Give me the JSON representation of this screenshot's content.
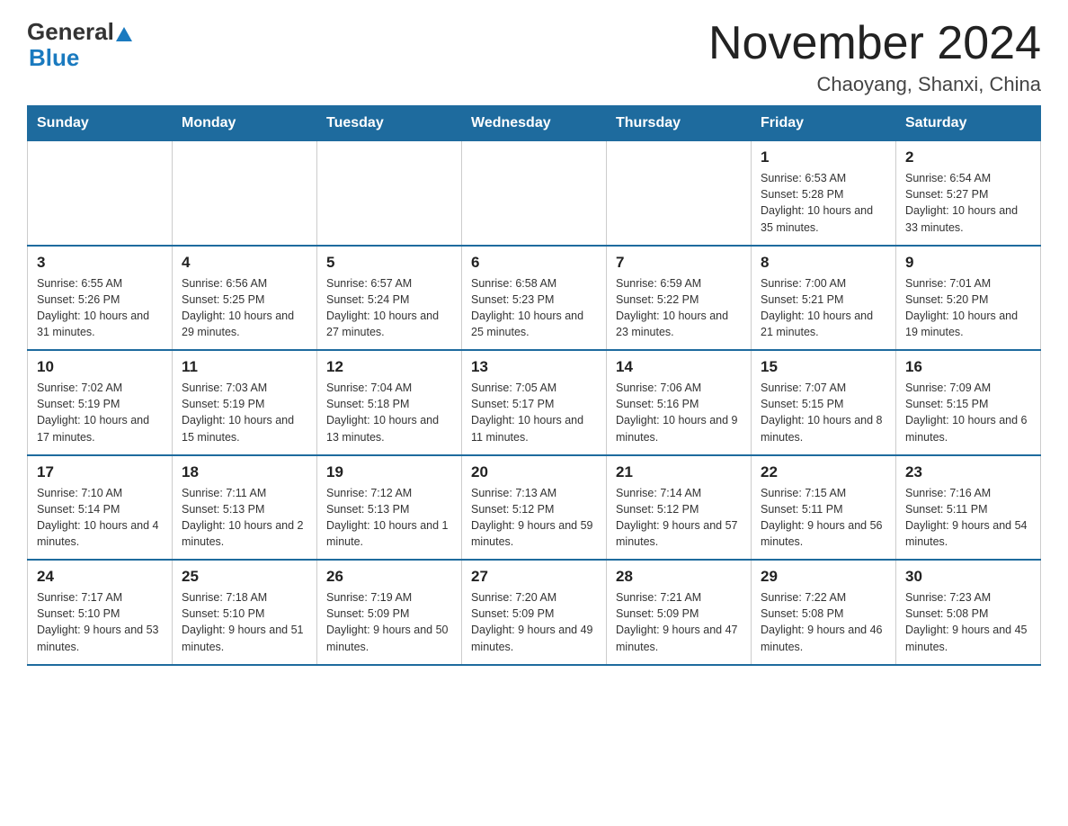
{
  "header": {
    "logo_general": "General",
    "logo_blue": "Blue",
    "month_title": "November 2024",
    "location": "Chaoyang, Shanxi, China"
  },
  "days_of_week": [
    "Sunday",
    "Monday",
    "Tuesday",
    "Wednesday",
    "Thursday",
    "Friday",
    "Saturday"
  ],
  "weeks": [
    [
      {
        "day": "",
        "info": ""
      },
      {
        "day": "",
        "info": ""
      },
      {
        "day": "",
        "info": ""
      },
      {
        "day": "",
        "info": ""
      },
      {
        "day": "",
        "info": ""
      },
      {
        "day": "1",
        "info": "Sunrise: 6:53 AM\nSunset: 5:28 PM\nDaylight: 10 hours and 35 minutes."
      },
      {
        "day": "2",
        "info": "Sunrise: 6:54 AM\nSunset: 5:27 PM\nDaylight: 10 hours and 33 minutes."
      }
    ],
    [
      {
        "day": "3",
        "info": "Sunrise: 6:55 AM\nSunset: 5:26 PM\nDaylight: 10 hours and 31 minutes."
      },
      {
        "day": "4",
        "info": "Sunrise: 6:56 AM\nSunset: 5:25 PM\nDaylight: 10 hours and 29 minutes."
      },
      {
        "day": "5",
        "info": "Sunrise: 6:57 AM\nSunset: 5:24 PM\nDaylight: 10 hours and 27 minutes."
      },
      {
        "day": "6",
        "info": "Sunrise: 6:58 AM\nSunset: 5:23 PM\nDaylight: 10 hours and 25 minutes."
      },
      {
        "day": "7",
        "info": "Sunrise: 6:59 AM\nSunset: 5:22 PM\nDaylight: 10 hours and 23 minutes."
      },
      {
        "day": "8",
        "info": "Sunrise: 7:00 AM\nSunset: 5:21 PM\nDaylight: 10 hours and 21 minutes."
      },
      {
        "day": "9",
        "info": "Sunrise: 7:01 AM\nSunset: 5:20 PM\nDaylight: 10 hours and 19 minutes."
      }
    ],
    [
      {
        "day": "10",
        "info": "Sunrise: 7:02 AM\nSunset: 5:19 PM\nDaylight: 10 hours and 17 minutes."
      },
      {
        "day": "11",
        "info": "Sunrise: 7:03 AM\nSunset: 5:19 PM\nDaylight: 10 hours and 15 minutes."
      },
      {
        "day": "12",
        "info": "Sunrise: 7:04 AM\nSunset: 5:18 PM\nDaylight: 10 hours and 13 minutes."
      },
      {
        "day": "13",
        "info": "Sunrise: 7:05 AM\nSunset: 5:17 PM\nDaylight: 10 hours and 11 minutes."
      },
      {
        "day": "14",
        "info": "Sunrise: 7:06 AM\nSunset: 5:16 PM\nDaylight: 10 hours and 9 minutes."
      },
      {
        "day": "15",
        "info": "Sunrise: 7:07 AM\nSunset: 5:15 PM\nDaylight: 10 hours and 8 minutes."
      },
      {
        "day": "16",
        "info": "Sunrise: 7:09 AM\nSunset: 5:15 PM\nDaylight: 10 hours and 6 minutes."
      }
    ],
    [
      {
        "day": "17",
        "info": "Sunrise: 7:10 AM\nSunset: 5:14 PM\nDaylight: 10 hours and 4 minutes."
      },
      {
        "day": "18",
        "info": "Sunrise: 7:11 AM\nSunset: 5:13 PM\nDaylight: 10 hours and 2 minutes."
      },
      {
        "day": "19",
        "info": "Sunrise: 7:12 AM\nSunset: 5:13 PM\nDaylight: 10 hours and 1 minute."
      },
      {
        "day": "20",
        "info": "Sunrise: 7:13 AM\nSunset: 5:12 PM\nDaylight: 9 hours and 59 minutes."
      },
      {
        "day": "21",
        "info": "Sunrise: 7:14 AM\nSunset: 5:12 PM\nDaylight: 9 hours and 57 minutes."
      },
      {
        "day": "22",
        "info": "Sunrise: 7:15 AM\nSunset: 5:11 PM\nDaylight: 9 hours and 56 minutes."
      },
      {
        "day": "23",
        "info": "Sunrise: 7:16 AM\nSunset: 5:11 PM\nDaylight: 9 hours and 54 minutes."
      }
    ],
    [
      {
        "day": "24",
        "info": "Sunrise: 7:17 AM\nSunset: 5:10 PM\nDaylight: 9 hours and 53 minutes."
      },
      {
        "day": "25",
        "info": "Sunrise: 7:18 AM\nSunset: 5:10 PM\nDaylight: 9 hours and 51 minutes."
      },
      {
        "day": "26",
        "info": "Sunrise: 7:19 AM\nSunset: 5:09 PM\nDaylight: 9 hours and 50 minutes."
      },
      {
        "day": "27",
        "info": "Sunrise: 7:20 AM\nSunset: 5:09 PM\nDaylight: 9 hours and 49 minutes."
      },
      {
        "day": "28",
        "info": "Sunrise: 7:21 AM\nSunset: 5:09 PM\nDaylight: 9 hours and 47 minutes."
      },
      {
        "day": "29",
        "info": "Sunrise: 7:22 AM\nSunset: 5:08 PM\nDaylight: 9 hours and 46 minutes."
      },
      {
        "day": "30",
        "info": "Sunrise: 7:23 AM\nSunset: 5:08 PM\nDaylight: 9 hours and 45 minutes."
      }
    ]
  ]
}
